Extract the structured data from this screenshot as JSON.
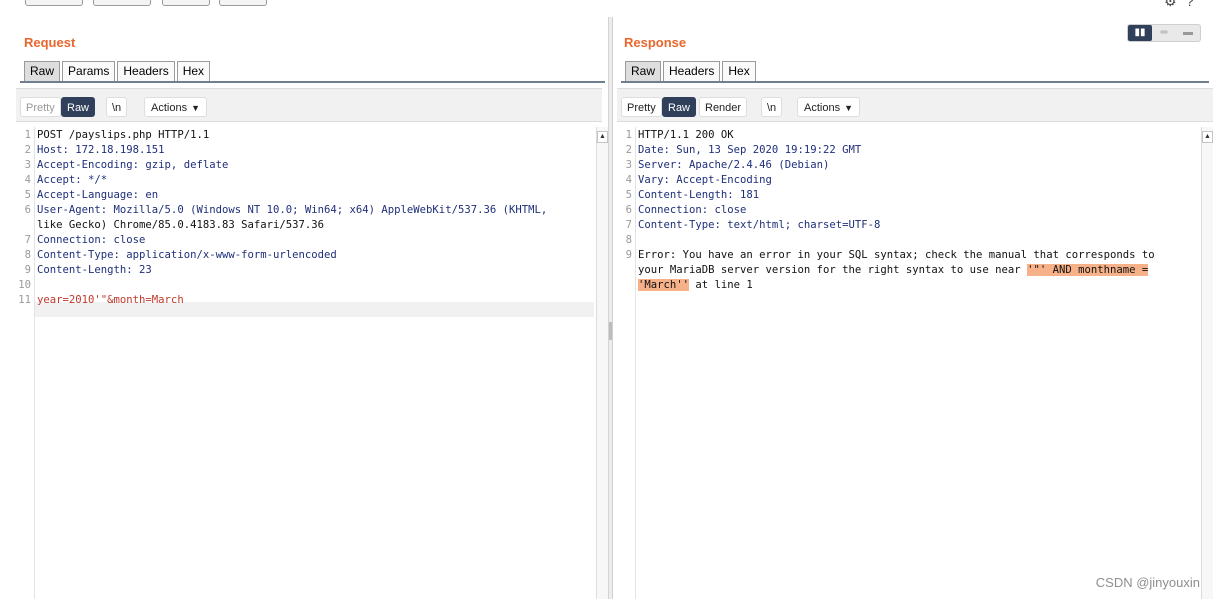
{
  "request": {
    "title": "Request",
    "tabs": [
      "Raw",
      "Params",
      "Headers",
      "Hex"
    ],
    "view_buttons": [
      "Pretty",
      "Raw",
      "\\n",
      "Actions"
    ],
    "line_numbers": [
      "1",
      "2",
      "3",
      "4",
      "5",
      "6",
      "",
      "7",
      "8",
      "9",
      "10",
      "11"
    ],
    "lines": [
      "POST /payslips.php HTTP/1.1",
      "Host: 172.18.198.151",
      "Accept-Encoding: gzip, deflate",
      "Accept: */*",
      "Accept-Language: en",
      "User-Agent: Mozilla/5.0 (Windows NT 10.0; Win64; x64) AppleWebKit/537.36 (KHTML,",
      "like Gecko) Chrome/85.0.4183.83 Safari/537.36",
      "Connection: close",
      "Content-Type: application/x-www-form-urlencoded",
      "Content-Length: 23",
      "",
      "year=2010'\"&month=March"
    ]
  },
  "response": {
    "title": "Response",
    "tabs": [
      "Raw",
      "Headers",
      "Hex"
    ],
    "view_buttons": [
      "Pretty",
      "Raw",
      "Render",
      "\\n",
      "Actions"
    ],
    "line_numbers": [
      "1",
      "2",
      "3",
      "4",
      "5",
      "6",
      "7",
      "8",
      "9",
      ""
    ],
    "lines": [
      "HTTP/1.1 200 OK",
      "Date: Sun, 13 Sep 2020 19:19:22 GMT",
      "Server: Apache/2.4.46 (Debian)",
      "Vary: Accept-Encoding",
      "Content-Length: 181",
      "Connection: close",
      "Content-Type: text/html; charset=UTF-8",
      "",
      "Error: You have an error in your SQL syntax; check the manual that corresponds to",
      "your MariaDB server version for the right syntax to use near '\"' AND monthname =",
      "'March'' at line 1"
    ]
  },
  "watermark": "CSDN @jinyouxin",
  "colors": {
    "accent": "#e8672f",
    "selected": "#30405a",
    "highlight": "#f6b189"
  }
}
